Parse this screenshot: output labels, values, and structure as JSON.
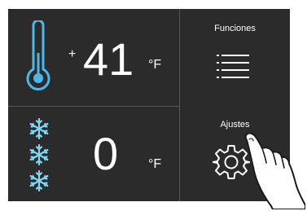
{
  "fridge": {
    "sign": "+",
    "value": "41",
    "unit": "°F",
    "icon": "thermometer-icon"
  },
  "freezer": {
    "value": "0",
    "unit": "°F",
    "icon": "snowflake-icon"
  },
  "functions_button": {
    "label": "Funciones",
    "icon": "menu-icon"
  },
  "settings_button": {
    "label": "Ajustes",
    "icon": "gear-icon"
  },
  "colors": {
    "panel": "#2b2b2b",
    "divider": "#555555",
    "text": "#ffffff",
    "thermometer": "#4ab8ea",
    "snowflake": "#7fd6f3"
  }
}
